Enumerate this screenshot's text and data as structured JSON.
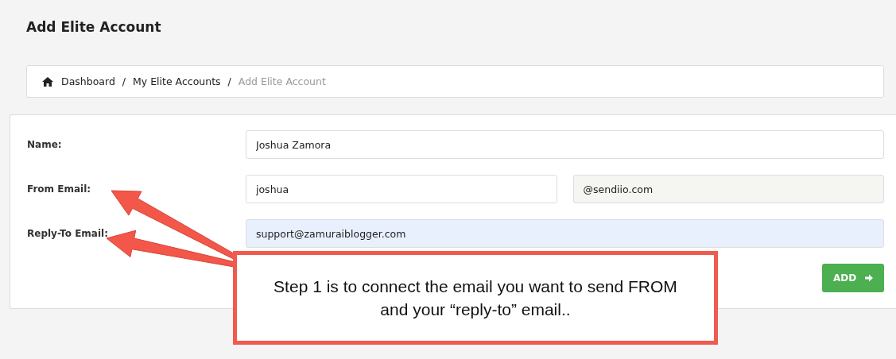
{
  "page_title": "Add Elite Account",
  "breadcrumb": [
    {
      "label": "Dashboard",
      "current": false
    },
    {
      "label": "My Elite Accounts",
      "current": false
    },
    {
      "label": "Add Elite Account",
      "current": true
    }
  ],
  "separator": "/",
  "form": {
    "rows": [
      {
        "label": "Name:",
        "fields": [
          {
            "value": "Joshua Zamora",
            "readonly": false,
            "autofilled": false
          }
        ]
      },
      {
        "label": "From Email:",
        "fields": [
          {
            "value": "joshua",
            "readonly": false,
            "autofilled": false
          },
          {
            "value": "@sendiio.com",
            "readonly": true,
            "autofilled": false
          }
        ]
      },
      {
        "label": "Reply-To Email:",
        "fields": [
          {
            "value": "support@zamuraiblogger.com",
            "readonly": false,
            "autofilled": true
          }
        ]
      }
    ],
    "submit": {
      "label": "ADD"
    }
  },
  "callout": {
    "text": "Step 1 is to connect the email you want to send FROM and your “reply-to” email.."
  }
}
